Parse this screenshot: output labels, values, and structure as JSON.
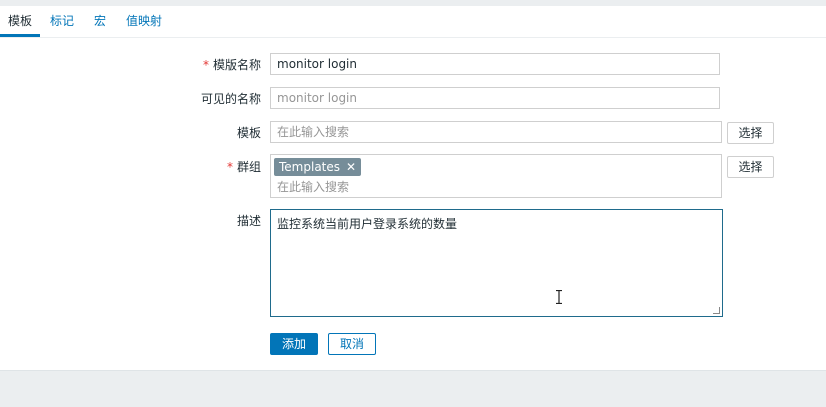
{
  "tabs": [
    {
      "label": "模板",
      "active": true
    },
    {
      "label": "标记",
      "active": false
    },
    {
      "label": "宏",
      "active": false
    },
    {
      "label": "值映射",
      "active": false
    }
  ],
  "form": {
    "template_name": {
      "required_mark": "*",
      "label": "模版名称",
      "value": "monitor login"
    },
    "visible_name": {
      "label": "可见的名称",
      "placeholder": "monitor login"
    },
    "templates": {
      "label": "模板",
      "placeholder": "在此输入搜索",
      "select_label": "选择"
    },
    "groups": {
      "required_mark": "*",
      "label": "群组",
      "tag": "Templates",
      "search_placeholder": "在此输入搜索",
      "select_label": "选择"
    },
    "description": {
      "label": "描述",
      "value": "监控系统当前用户登录系统的数量"
    }
  },
  "actions": {
    "add_label": "添加",
    "cancel_label": "取消"
  },
  "colors": {
    "accent": "#0275b8",
    "required": "#e33734",
    "tag_bg": "#768d99"
  }
}
